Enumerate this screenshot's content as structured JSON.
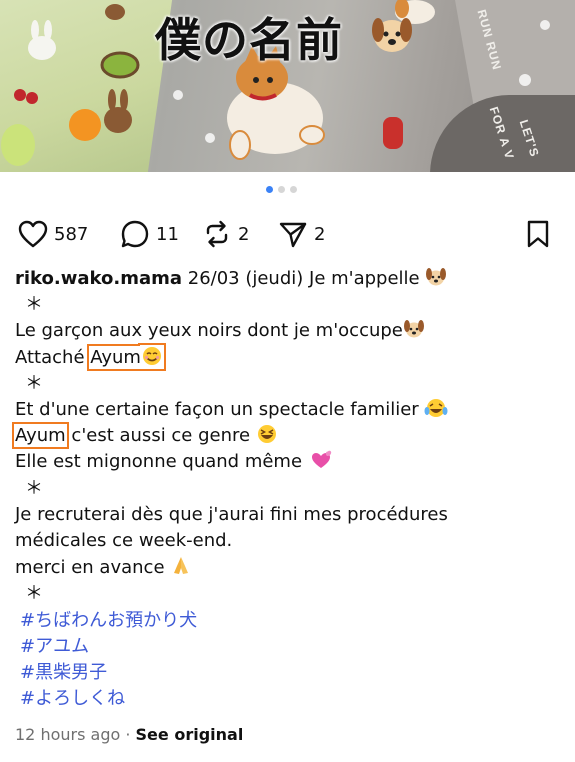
{
  "photo": {
    "title": "僕の名前",
    "mat_text_1": "RUN RUN",
    "mat_text_2": "LET'S",
    "mat_text_3": "FOR A V"
  },
  "pager": {
    "count": 3,
    "active": 0
  },
  "actions": {
    "likes": "587",
    "comments": "11",
    "reposts": "2",
    "shares": "2"
  },
  "caption": {
    "username": "riko.wako.mama",
    "header_text": " 26/03 (jeudi) Je m'appelle ",
    "star": "＊",
    "line_garcon": "Le garçon aux yeux noirs dont je m'occupe",
    "attache": "Attaché ",
    "ayum": "Ayum",
    "line_facon": "Et d'une certaine façon un spectacle familier ",
    "genre_rest": "c'est aussi ce genre ",
    "line_mignonne": "Elle est mignonne quand même ",
    "line_recruterai": "Je recruterai dès que j'aurai fini mes procédures",
    "line_medicales": "médicales ce week-end.",
    "line_merci": "merci en avance ",
    "hashtags": [
      "#ちばわんお預かり犬",
      "#アユム",
      "#黒柴男子",
      "#よろしくね"
    ]
  },
  "meta": {
    "time": "12 hours ago",
    "separator": " · ",
    "see_original": "See original"
  },
  "colors": {
    "hashtag": "#3f5bd6",
    "highlight_box": "#f07b20",
    "pager_active": "#3b82f6"
  }
}
